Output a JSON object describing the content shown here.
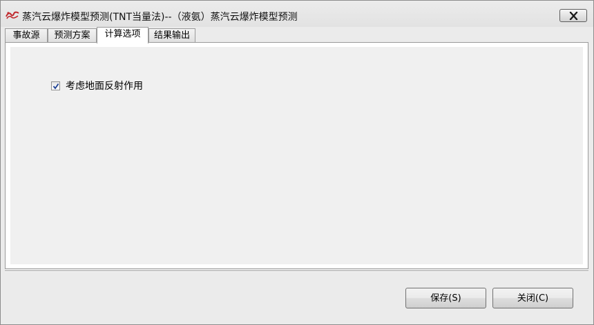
{
  "window": {
    "title": "蒸汽云爆炸模型预测(TNT当量法)--（液氨）蒸汽云爆炸模型预测",
    "app_icon": "app-logo-icon",
    "close_icon": "close-icon"
  },
  "tabs": [
    {
      "label": "事故源",
      "active": false
    },
    {
      "label": "预测方案",
      "active": false
    },
    {
      "label": "计算选项",
      "active": true
    },
    {
      "label": "结果输出",
      "active": false
    }
  ],
  "options": {
    "ground_reflection": {
      "label": "考虑地面反射作用",
      "checked": true
    }
  },
  "buttons": {
    "save_label": "保存(S)",
    "close_label": "关闭(C)"
  },
  "colors": {
    "panel_background": "#f0f0f0",
    "window_background": "#ebebeb",
    "icon_red": "#c0282d"
  }
}
